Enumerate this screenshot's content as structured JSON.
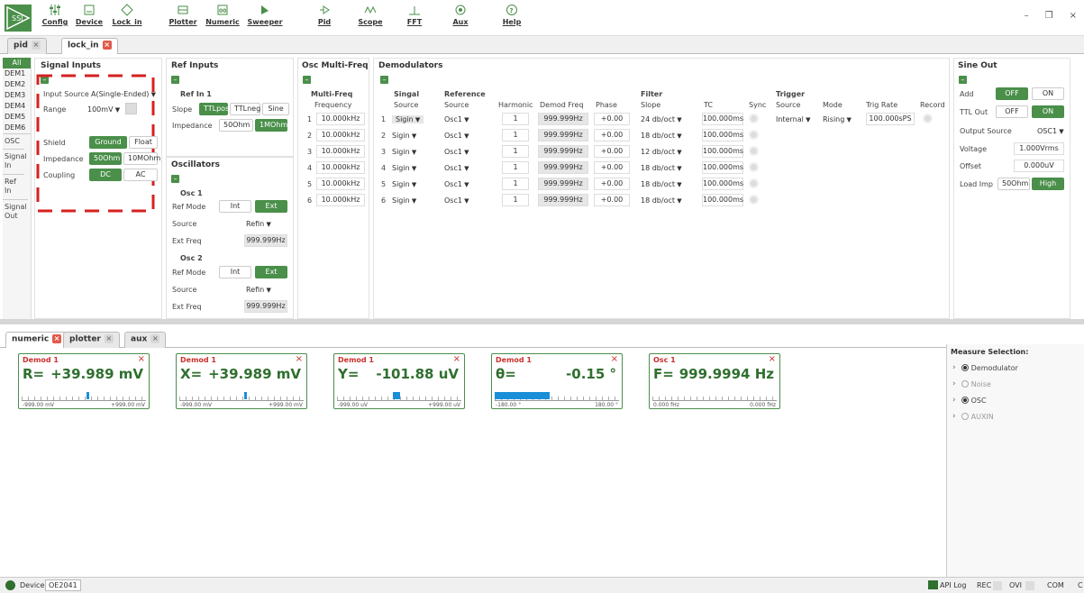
{
  "ribbon": {
    "items": [
      "Config",
      "Device",
      "Lock_in",
      "Plotter",
      "Numeric",
      "Sweeper",
      "Pid",
      "Scope",
      "FFT",
      "Aux",
      "Help"
    ]
  },
  "tabs_top": [
    {
      "label": "pid"
    },
    {
      "label": "lock_in"
    }
  ],
  "nav": {
    "items": [
      "All",
      "DEM1",
      "DEM2",
      "DEM3",
      "DEM4",
      "DEM5",
      "DEM6",
      "OSC"
    ],
    "blocks": [
      "Signal In",
      "Ref In",
      "Signal Out"
    ]
  },
  "signal_inputs": {
    "title": "Signal Inputs",
    "input_source_label": "Input Source",
    "input_source": "A(Single-Ended)",
    "range_label": "Range",
    "range": "100mV",
    "shield_label": "Shield",
    "shield_opts": [
      "Ground",
      "Float"
    ],
    "impedance_label": "Impedance",
    "impedance_opts": [
      "50Ohm",
      "10MOhm"
    ],
    "coupling_label": "Coupling",
    "coupling_opts": [
      "DC",
      "AC"
    ]
  },
  "ref_inputs": {
    "title": "Ref Inputs",
    "sub": "Ref In 1",
    "slope_label": "Slope",
    "slope_opts": [
      "TTLpos",
      "TTLneg",
      "Sine"
    ],
    "imp_label": "Impedance",
    "imp_opts": [
      "50Ohm",
      "1MOhm"
    ]
  },
  "oscillators": {
    "title": "Oscillators",
    "osc1": "Osc 1",
    "osc2": "Osc 2",
    "refmode_label": "Ref Mode",
    "refmode_opts": [
      "Int",
      "Ext"
    ],
    "source_label": "Source",
    "source": "Refin",
    "extfreq_label": "Ext Freq",
    "extfreq": "999.999Hz"
  },
  "osc_multi": {
    "title": "Osc Multi-Freq",
    "sub": "Multi-Freq",
    "col": "Frequency",
    "rows": [
      {
        "n": "1",
        "f": "10.000kHz"
      },
      {
        "n": "2",
        "f": "10.000kHz"
      },
      {
        "n": "3",
        "f": "10.000kHz"
      },
      {
        "n": "4",
        "f": "10.000kHz"
      },
      {
        "n": "5",
        "f": "10.000kHz"
      },
      {
        "n": "6",
        "f": "10.000kHz"
      }
    ]
  },
  "demods": {
    "title": "Demodulators",
    "headers": {
      "signal": "Singal",
      "signal_sub": "Source",
      "reference": "Reference",
      "reference_sub": "Source",
      "harmonic": "Harmonic",
      "freq": "Demod Freq",
      "phase": "Phase",
      "filter": "Filter",
      "filter_sub": "Slope",
      "tc": "TC",
      "sync": "Sync",
      "trigger": "Trigger",
      "trig_sub": "Source",
      "mode": "Mode",
      "rate": "Trig Rate",
      "record": "Record"
    },
    "rows": [
      {
        "n": "1",
        "sig": "Sigin",
        "ref": "Osc1",
        "h": "1",
        "f": "999.999Hz",
        "p": "+0.00",
        "slope": "24 db/oct",
        "tc": "100.000ms"
      },
      {
        "n": "2",
        "sig": "Sigin",
        "ref": "Osc1",
        "h": "1",
        "f": "999.999Hz",
        "p": "+0.00",
        "slope": "18 db/oct",
        "tc": "100.000ms"
      },
      {
        "n": "3",
        "sig": "Sigin",
        "ref": "Osc1",
        "h": "1",
        "f": "999.999Hz",
        "p": "+0.00",
        "slope": "12 db/oct",
        "tc": "100.000ms"
      },
      {
        "n": "4",
        "sig": "Sigin",
        "ref": "Osc1",
        "h": "1",
        "f": "999.999Hz",
        "p": "+0.00",
        "slope": "18 db/oct",
        "tc": "100.000ms"
      },
      {
        "n": "5",
        "sig": "Sigin",
        "ref": "Osc1",
        "h": "1",
        "f": "999.999Hz",
        "p": "+0.00",
        "slope": "18 db/oct",
        "tc": "100.000ms"
      },
      {
        "n": "6",
        "sig": "Sigin",
        "ref": "Osc1",
        "h": "1",
        "f": "999.999Hz",
        "p": "+0.00",
        "slope": "18 db/oct",
        "tc": "100.000ms"
      }
    ],
    "trigger": {
      "source": "Internal",
      "mode": "Rising",
      "rate": "100.000sPS"
    }
  },
  "sine_out": {
    "title": "Sine Out",
    "add_label": "Add",
    "add_opts": [
      "OFF",
      "ON"
    ],
    "ttl_label": "TTL Out",
    "ttl_opts": [
      "OFF",
      "ON"
    ],
    "outsrc_label": "Output Source",
    "outsrc": "OSC1",
    "voltage_label": "Voltage",
    "voltage": "1.000Vrms",
    "offset_label": "Offset",
    "offset": "0.000uV",
    "load_label": "Load Imp",
    "load_opts": [
      "50Ohm",
      "High Z"
    ]
  },
  "tabs_bottom": [
    {
      "label": "numeric"
    },
    {
      "label": "plotter"
    },
    {
      "label": "aux"
    }
  ],
  "meters": [
    {
      "title": "Demod 1",
      "name": "R=",
      "value": "+39.989 mV",
      "lo": "-999.00 mV",
      "hi": "+999.00 mV",
      "level": 0.52,
      "width": 0.02
    },
    {
      "title": "Demod 1",
      "name": "X=",
      "value": "+39.989 mV",
      "lo": "-999.00 mV",
      "hi": "+999.00 mV",
      "level": 0.52,
      "width": 0.02
    },
    {
      "title": "Demod 1",
      "name": "Y=",
      "value": "-101.88 uV",
      "lo": "-999.00 uV",
      "hi": "+999.00 uV",
      "level": 0.45,
      "width": 0.06
    },
    {
      "title": "Demod 1",
      "name": "θ=",
      "value": "-0.15 °",
      "lo": "-180.00 °",
      "hi": "180.00 °",
      "level": 0.0,
      "width": 0.44
    },
    {
      "title": "Osc 1",
      "name": "F=",
      "value": "999.9994 Hz",
      "lo": "0.000 fHz",
      "hi": "0.000 fHz",
      "level": 0,
      "width": 0
    }
  ],
  "measure": {
    "title": "Measure Selection:",
    "items": [
      {
        "label": "Demodulator",
        "state": "on"
      },
      {
        "label": "Noise",
        "state": "off"
      },
      {
        "label": "OSC",
        "state": "on"
      },
      {
        "label": "AUXIN",
        "state": "off"
      }
    ]
  },
  "status": {
    "device_label": "Device",
    "device": "OE2041",
    "api": "API Log",
    "rec": "REC",
    "ovi": "OVI",
    "com": "COM",
    "c": "C"
  }
}
